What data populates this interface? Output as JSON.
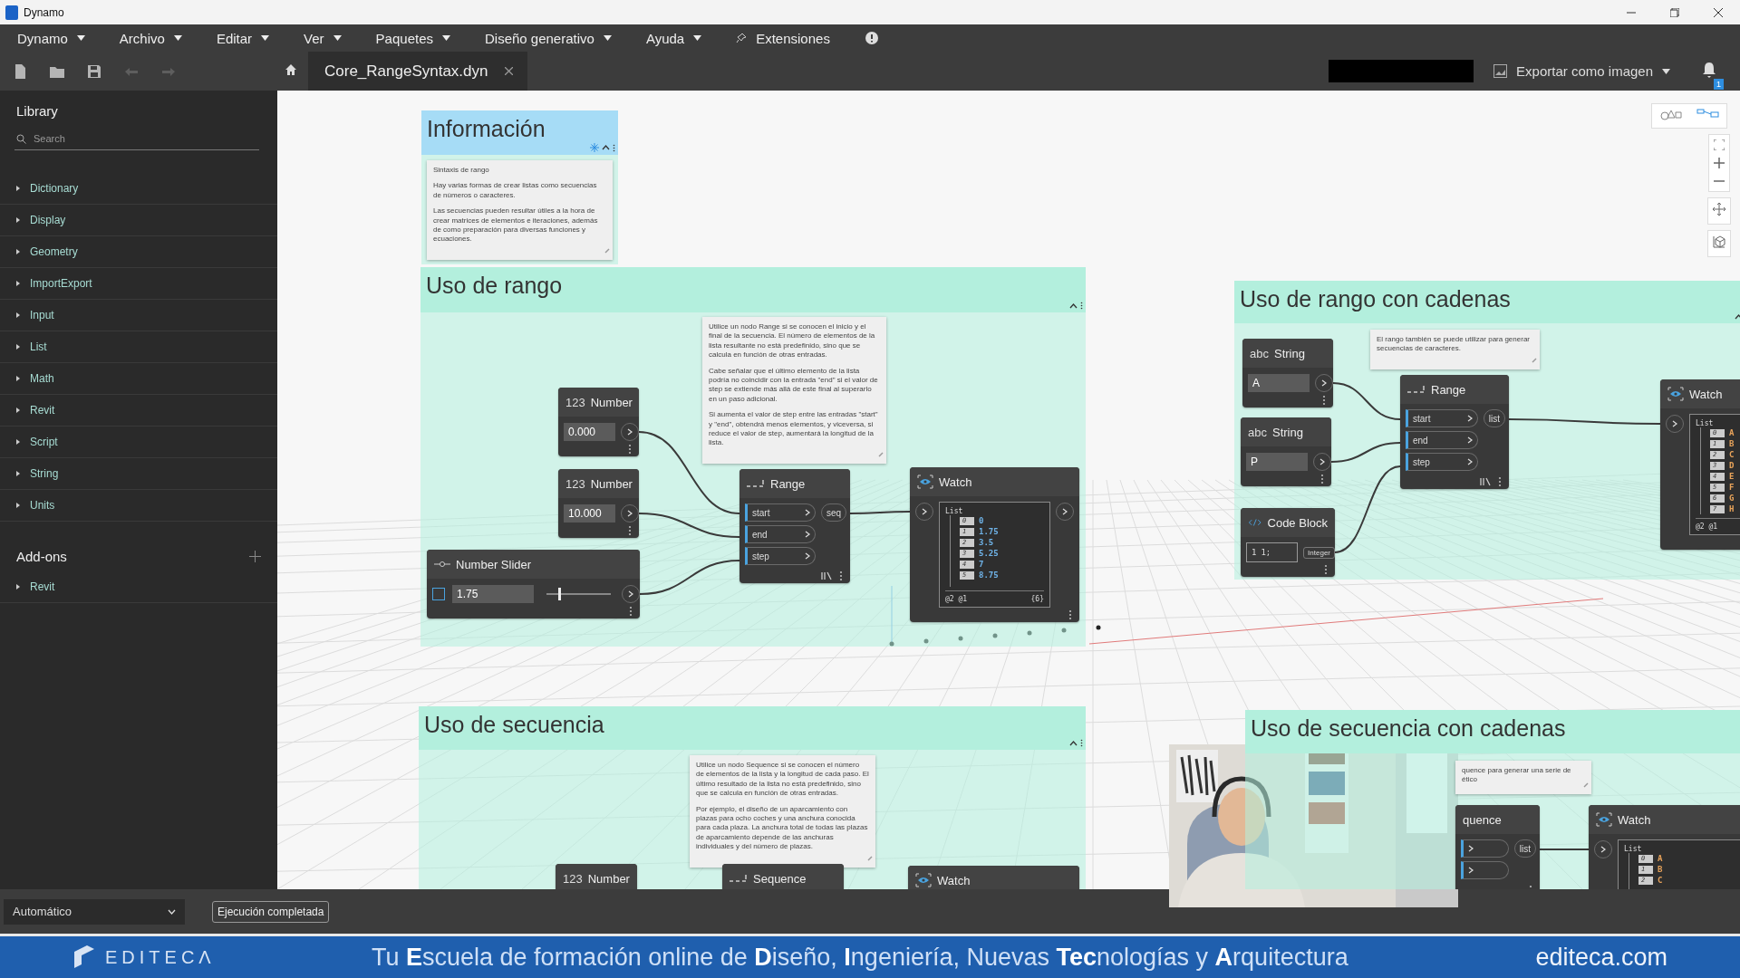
{
  "window": {
    "title": "Dynamo"
  },
  "menu": [
    {
      "label": "Dynamo",
      "kind": "dropdown"
    },
    {
      "label": "Archivo",
      "kind": "dropdown"
    },
    {
      "label": "Editar",
      "kind": "dropdown"
    },
    {
      "label": "Ver",
      "kind": "dropdown"
    },
    {
      "label": "Paquetes",
      "kind": "dropdown"
    },
    {
      "label": "Diseño generativo",
      "kind": "dropdown"
    },
    {
      "label": "Ayuda",
      "kind": "dropdown"
    },
    {
      "label": "Extensiones",
      "kind": "pinned"
    },
    {
      "kind": "info"
    }
  ],
  "toolbar": {
    "buttons": [
      {
        "kind": "new",
        "disabled": false
      },
      {
        "kind": "open",
        "disabled": false
      },
      {
        "kind": "save",
        "disabled": false
      },
      {
        "kind": "undo",
        "disabled": true
      },
      {
        "kind": "redo",
        "disabled": true
      }
    ],
    "tabs": [
      {
        "label": "Core_RangeSyntax.dyn",
        "selected": true
      }
    ],
    "export": {
      "label": "Exportar como imagen"
    },
    "notifications": {
      "count": "1"
    }
  },
  "library": {
    "title": "Library",
    "search": {
      "placeholder": "Search"
    },
    "items": [
      "Dictionary",
      "Display",
      "Geometry",
      "ImportExport",
      "Input",
      "List",
      "Math",
      "Revit",
      "Script",
      "String",
      "Units"
    ],
    "addons_title": "Add-ons",
    "addons": [
      "Revit"
    ]
  },
  "canvas": {
    "view_toggle": [
      {
        "kind": "geometry",
        "selected": false
      },
      {
        "kind": "graph",
        "selected": true
      }
    ],
    "groups": [
      {
        "title": "Información",
        "color": "#a6dcf6"
      },
      {
        "title": "Uso de rango",
        "color": "#b3efdd"
      },
      {
        "title": "Uso de rango con cadenas",
        "color": "#b3efdd"
      },
      {
        "title": "Uso de secuencia",
        "color": "#b3efdd"
      },
      {
        "title": "Uso de secuencia con cadenas",
        "color": "#b3efdd"
      }
    ],
    "notes": [
      {
        "paragraphs": [
          "Sintaxis de rango",
          "Hay varias formas de crear listas como secuencias de números o caracteres.",
          "Las secuencias pueden resultar útiles a la hora de crear matrices de elementos e iteraciones, además de como preparación para diversas funciones y ecuaciones."
        ]
      },
      {
        "paragraphs": [
          "Utilice un nodo Range si se conocen el inicio y el final de la secuencia. El número de elementos de la lista resultante no está predefinido, sino que se calcula en función de otras entradas.",
          "Cabe señalar que el último elemento de la lista podría no coincidir con la entrada \"end\" si el valor de step se extiende más allá de este final al superarlo en un paso adicional.",
          "Si aumenta el valor de step entre las entradas \"start\" y \"end\", obtendrá menos elementos, y viceversa, si reduce el valor de step, aumentará la longitud de la lista."
        ]
      },
      {
        "paragraphs": [
          "El rango también se puede utilizar para generar secuencias de caracteres."
        ]
      },
      {
        "paragraphs": [
          "Utilice un nodo Sequence si se conocen el número de elementos de la lista y la longitud de cada paso. El último resultado de la lista no está predefinido, sino que se calcula en función de otras entradas.",
          "Por ejemplo, el diseño de un aparcamiento con plazas para ocho coches y una anchura conocida para cada plaza. La anchura total de todas las plazas de aparcamiento depende de las anchuras individuales y del número de plazas."
        ]
      },
      {
        "lines": [
          "quence para generar una serie de",
          "ético"
        ]
      }
    ],
    "nodes": [
      {
        "kind": "number",
        "badge": "123",
        "title": "Number",
        "value": "0.000"
      },
      {
        "kind": "number",
        "badge": "123",
        "title": "Number",
        "value": "10.000"
      },
      {
        "kind": "slider",
        "title": "Number Slider",
        "value": "1.75",
        "level": 0.19
      },
      {
        "kind": "range",
        "title": "Range",
        "inputs": [
          "start",
          "end",
          "step"
        ],
        "output": "seq"
      },
      {
        "kind": "watch",
        "title": "Watch",
        "list_label": "List",
        "color": "#6fb3e8",
        "items": [
          {
            "index": "0",
            "value": "0"
          },
          {
            "index": "1",
            "value": "1.75"
          },
          {
            "index": "2",
            "value": "3.5"
          },
          {
            "index": "3",
            "value": "5.25"
          },
          {
            "index": "4",
            "value": "7"
          },
          {
            "index": "5",
            "value": "8.75"
          }
        ],
        "footer_left": "@2 @1",
        "footer_right": "{6}"
      },
      {
        "kind": "string",
        "badge": "abc",
        "title": "String",
        "value": "A"
      },
      {
        "kind": "string",
        "badge": "abc",
        "title": "String",
        "value": "P"
      },
      {
        "kind": "code",
        "title": "Code Block",
        "line": "1",
        "code": "1;",
        "output": "Integer"
      },
      {
        "kind": "range",
        "title": "Range",
        "inputs": [
          "start",
          "end",
          "step"
        ],
        "output": "list"
      },
      {
        "kind": "watch",
        "title": "Watch",
        "list_label": "List",
        "color": "#e8a35a",
        "items": [
          {
            "index": "0",
            "value": "A"
          },
          {
            "index": "1",
            "value": "B"
          },
          {
            "index": "2",
            "value": "C"
          },
          {
            "index": "3",
            "value": "D"
          },
          {
            "index": "4",
            "value": "E"
          },
          {
            "index": "5",
            "value": "F"
          },
          {
            "index": "6",
            "value": "G"
          },
          {
            "index": "7",
            "value": "H"
          }
        ],
        "footer_left": "@2 @1"
      },
      {
        "kind": "number",
        "badge": "123",
        "title": "Number"
      },
      {
        "kind": "sequence",
        "title": "Sequence"
      },
      {
        "kind": "watch",
        "title": "Watch"
      },
      {
        "kind": "sequence",
        "title": "quence",
        "output": "list"
      },
      {
        "kind": "watch",
        "title": "Watch",
        "list_label": "List",
        "color": "#e8a35a",
        "items": [
          {
            "index": "0",
            "value": "A"
          },
          {
            "index": "1",
            "value": "B"
          },
          {
            "index": "2",
            "value": "C"
          }
        ]
      }
    ]
  },
  "status_bar": {
    "run_mode": "Automático",
    "run_status": "Ejecución completada"
  },
  "banner": {
    "logo": "EDITECΛ",
    "slogan": "Tu **E**scuela de formación online de **D**iseño, **I**ngeniería, Nuevas **Tec**nologías y **A**rquitectura",
    "site": "editeca.com"
  }
}
